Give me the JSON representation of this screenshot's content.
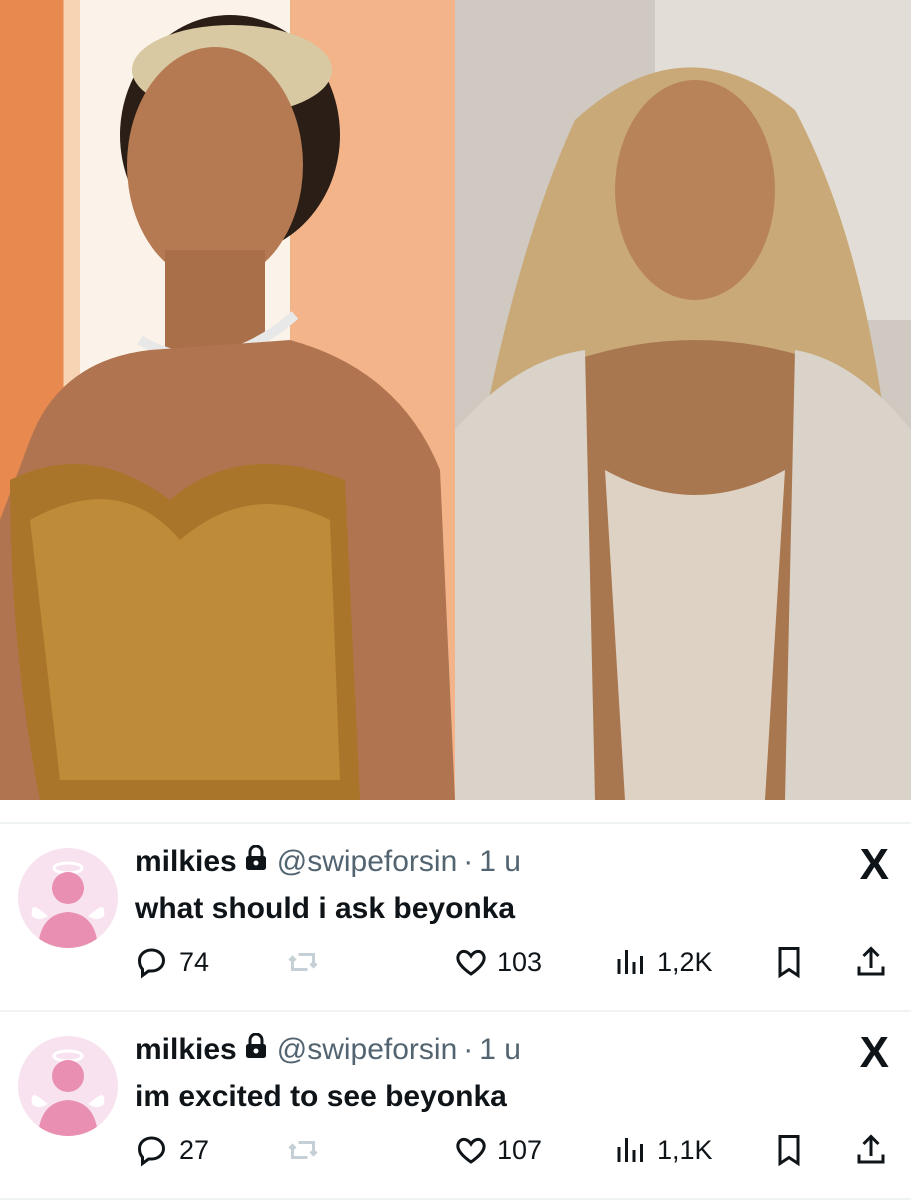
{
  "tweets": [
    {
      "name": "milkies",
      "handle": "@swipeforsin",
      "separator": "·",
      "time": "1 u",
      "text": "what should i ask beyonka",
      "replies": "74",
      "likes": "103",
      "views": "1,2K",
      "logo": "X"
    },
    {
      "name": "milkies",
      "handle": "@swipeforsin",
      "separator": "·",
      "time": "1 u",
      "text": "im excited to see beyonka",
      "replies": "27",
      "likes": "107",
      "views": "1,1K",
      "logo": "X"
    }
  ],
  "icons": {
    "lock": "lock-icon",
    "reply": "reply-icon",
    "retweet": "retweet-icon",
    "like": "heart-icon",
    "views": "views-icon",
    "bookmark": "bookmark-icon",
    "share": "share-icon"
  },
  "colors": {
    "text_primary": "#0f1419",
    "text_secondary": "#536471",
    "retweet_disabled": "#c4cfd6",
    "avatar_bg": "#f8e2ef",
    "avatar_figure": "#e98fb1"
  }
}
